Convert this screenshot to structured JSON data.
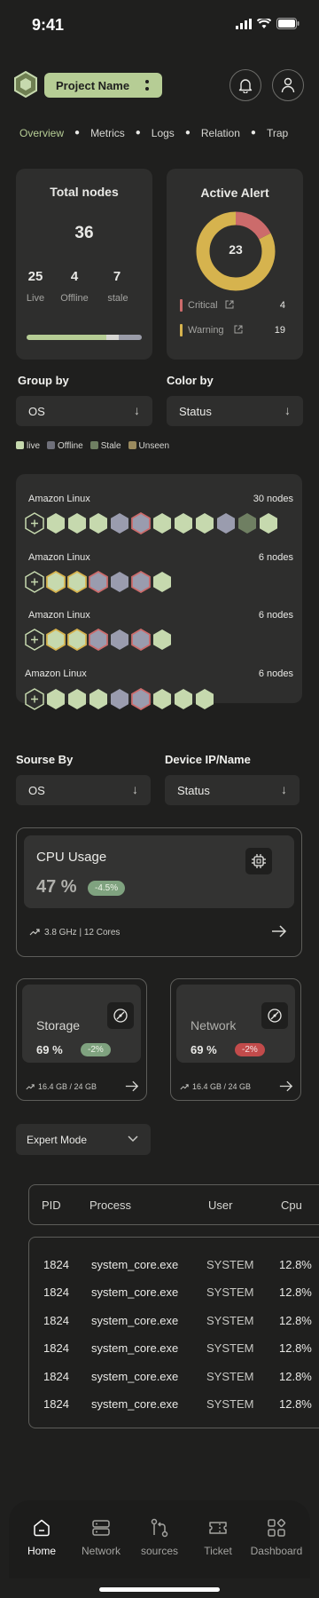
{
  "status_bar": {
    "time": "9:41"
  },
  "header": {
    "project_name": "Project Name"
  },
  "tabs": [
    "Overview",
    "Metrics",
    "Logs",
    "Relation",
    "Trap"
  ],
  "total_nodes": {
    "title": "Total nodes",
    "total": "36",
    "stats": [
      {
        "value": "25",
        "label": "Live"
      },
      {
        "value": "4",
        "label": "Offline"
      },
      {
        "value": "7",
        "label": "stale"
      }
    ],
    "bar": [
      {
        "fraction": 0.69,
        "color": "#b6cd95"
      },
      {
        "fraction": 0.11,
        "color": "#d7d7d3"
      },
      {
        "fraction": 0.2,
        "color": "#9a9ca8"
      }
    ]
  },
  "active_alert": {
    "title": "Active Alert",
    "total": "23",
    "items": [
      {
        "label": "Critical",
        "value": "4",
        "color": "#cc6b6b"
      },
      {
        "label": "Warning",
        "value": "19",
        "color": "#d6b34e"
      }
    ]
  },
  "filters": {
    "group_by": {
      "label": "Group by",
      "value": "OS"
    },
    "color_by": {
      "label": "Color by",
      "value": "Status"
    }
  },
  "legend": [
    {
      "label": "live",
      "color": "#c6d9ae"
    },
    {
      "label": "Offline",
      "color": "#6f707a"
    },
    {
      "label": "Stale",
      "color": "#6f7f62"
    },
    {
      "label": "Unseen",
      "color": "#9a8a5e"
    }
  ],
  "groups": [
    {
      "name": "Amazon Linux",
      "count": "30 nodes",
      "hexes": [
        "#c6d9ae",
        "#c6d9ae",
        "#c6d9ae",
        "#9a9cae",
        "crit",
        "#c6d9ae",
        "#c6d9ae",
        "#c6d9ae",
        "#9a9cae",
        "#6f7f62",
        "#c6d9ae"
      ]
    },
    {
      "name": "Amazon Linux",
      "count": "6 nodes",
      "hexes": [
        "warn",
        "warn",
        "crit",
        "#9a9cae",
        "crit",
        "#c6d9ae"
      ]
    },
    {
      "name": "Amazon Linux",
      "count": "6 nodes",
      "hexes": [
        "warn",
        "warn",
        "crit",
        "#9a9cae",
        "crit",
        "#c6d9ae"
      ]
    },
    {
      "name": "Amazon Linux",
      "count": "6 nodes",
      "hexes": [
        "#c6d9ae",
        "#c6d9ae",
        "#c6d9ae",
        "#9a9cae",
        "crit",
        "#c6d9ae",
        "#c6d9ae",
        "#c6d9ae"
      ]
    }
  ],
  "device_filters": {
    "source_by": {
      "label": "Sourse By",
      "value": "OS"
    },
    "device": {
      "label": "Device IP/Name",
      "value": "Status"
    }
  },
  "cpu": {
    "title": "CPU Usage",
    "value": "47 %",
    "delta": "-4.5%",
    "footer": "3.8 GHz | 12 Cores"
  },
  "storage": {
    "title": "Storage",
    "value": "69 %",
    "delta": "-2%",
    "footer": "16.4 GB / 24 GB"
  },
  "network": {
    "title": "Network",
    "value": "69 %",
    "delta": "-2%",
    "footer": "16.4 GB / 24 GB"
  },
  "expert_mode": {
    "label": "Expert Mode"
  },
  "table": {
    "headers": [
      "PID",
      "Process",
      "User",
      "Cpu"
    ],
    "rows": [
      [
        "1824",
        "system_core.exe",
        "SYSTEM",
        "12.8%"
      ],
      [
        "1824",
        "system_core.exe",
        "SYSTEM",
        "12.8%"
      ],
      [
        "1824",
        "system_core.exe",
        "SYSTEM",
        "12.8%"
      ],
      [
        "1824",
        "system_core.exe",
        "SYSTEM",
        "12.8%"
      ],
      [
        "1824",
        "system_core.exe",
        "SYSTEM",
        "12.8%"
      ],
      [
        "1824",
        "system_core.exe",
        "SYSTEM",
        "12.8%"
      ]
    ]
  },
  "bottom_nav": [
    {
      "label": "Home",
      "icon": "home-icon",
      "active": true
    },
    {
      "label": "Network",
      "icon": "server-icon",
      "active": false
    },
    {
      "label": "sources",
      "icon": "git-branch-icon",
      "active": false
    },
    {
      "label": "Ticket",
      "icon": "ticket-icon",
      "active": false
    },
    {
      "label": "Dashboard",
      "icon": "dashboard-icon",
      "active": false
    }
  ]
}
